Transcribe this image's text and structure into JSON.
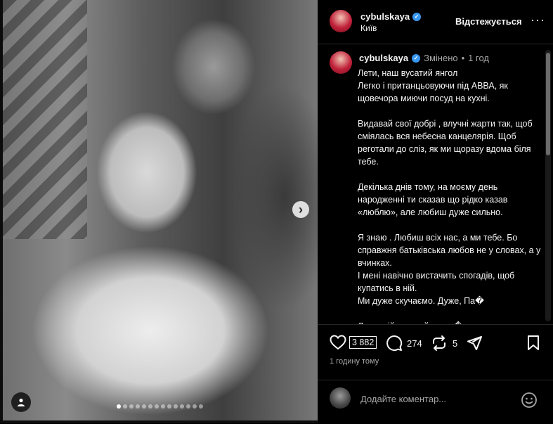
{
  "post": {
    "username": "cybulskaya",
    "location": "Київ",
    "follow_label": "Відстежується",
    "more_label": "···"
  },
  "caption": {
    "username": "cybulskaya",
    "edited_label": "Змінено",
    "separator": "•",
    "time_ago": "1 год",
    "text": "Лети, наш вусатий янгол\nЛегко і пританцьовуючи під АВВА, як щовечора миючи посуд на кухні.\n\nВидавай свої добрі , влучні жарти так, щоб сміялась вся небесна канцелярія. Щоб реготали до сліз, як ми щоразу вдома біля тебе.\n\nДекілька днів тому, на моєму день народженні ти сказав що рідко казав «люблю», але любиш дуже сильно.\n\nЯ знаю . Любиш всіх нас, а ми тебе. Бо справжня батьківська любов не у словах, а у вчинках.\nІ мені навічно вистачить спогадів, щоб купатись в ній.\nМи дуже скучаємо. Дуже, Па�\n\nЛети, мій вусатий янгол�"
  },
  "actions": {
    "likes": "3 882",
    "comments": "274",
    "reposts": "5"
  },
  "timestamp": "1 годину тому",
  "comment_input": {
    "placeholder": "Додайте коментар..."
  },
  "carousel": {
    "total_slides": 14,
    "active_index": 0
  },
  "icons": {
    "next": "chevron-right-icon",
    "tag": "user-tag-icon",
    "like": "heart-icon",
    "comment": "comment-icon",
    "repost": "repost-icon",
    "share": "send-icon",
    "save": "bookmark-icon",
    "emoji": "emoji-icon",
    "verified": "verified-badge-icon"
  },
  "colors": {
    "background": "#000000",
    "verified": "#3897f0",
    "muted_text": "#a8a8a8",
    "divider": "#262626"
  }
}
